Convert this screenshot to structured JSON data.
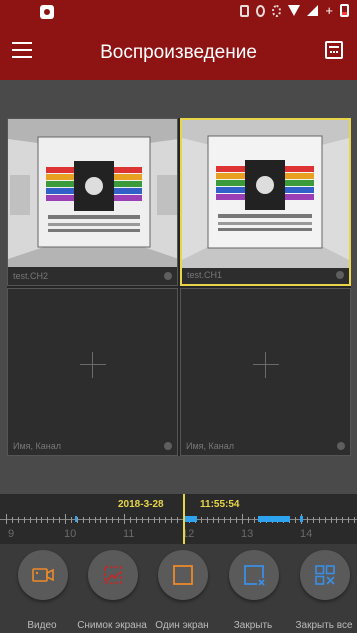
{
  "app": {
    "title": "Воспроизведение"
  },
  "colors": {
    "accent": "#8e1414",
    "highlight": "#e8d54a",
    "record": "#2ea3ef",
    "snapshot_icon": "#c42828",
    "icon_orange": "#ec8a2a",
    "icon_blue": "#3b8ee6"
  },
  "icons": {
    "menu": "hamburger-icon",
    "calendar": "calendar-icon"
  },
  "cells": [
    {
      "label": "test.CH2",
      "state": "video",
      "selected": false
    },
    {
      "label": "test.CH1",
      "state": "video",
      "selected": true
    },
    {
      "label": "Имя, Канал",
      "state": "empty",
      "selected": false
    },
    {
      "label": "Имя, Канал",
      "state": "empty",
      "selected": false
    }
  ],
  "timeline": {
    "date": "2018-3-28",
    "time": "11:55:54",
    "hours": [
      "9",
      "10",
      "11",
      "12",
      "13",
      "14"
    ]
  },
  "toolbar": [
    {
      "label": "Видео",
      "icon": "video-camera-icon"
    },
    {
      "label": "Снимок экрана",
      "icon": "snapshot-icon"
    },
    {
      "label": "Один экран",
      "icon": "single-screen-icon"
    },
    {
      "label": "Закрыть",
      "icon": "close-window-icon"
    },
    {
      "label": "Закрыть все",
      "icon": "close-all-icon"
    }
  ]
}
